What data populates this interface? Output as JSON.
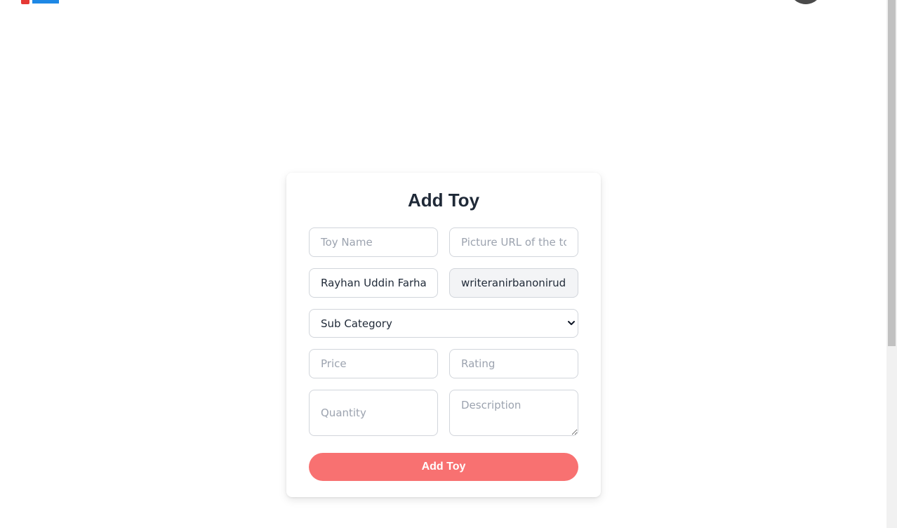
{
  "header": {
    "logo_icon": "toy-blocks-logo-icon",
    "avatar_icon": "user-avatar-icon"
  },
  "form": {
    "title": "Add Toy",
    "toy_name": {
      "value": "",
      "placeholder": "Toy Name"
    },
    "picture_url": {
      "value": "",
      "placeholder": "Picture URL of the toy"
    },
    "seller_name": {
      "value": "Rayhan Uddin Farhad"
    },
    "seller_email": {
      "value": "writeranirbanonirudro"
    },
    "sub_category": {
      "selected": "Sub Category"
    },
    "price": {
      "value": "",
      "placeholder": "Price"
    },
    "rating": {
      "value": "",
      "placeholder": "Rating"
    },
    "quantity": {
      "value": "",
      "placeholder": "Quantity"
    },
    "description": {
      "value": "",
      "placeholder": "Description"
    },
    "submit_label": "Add Toy"
  },
  "colors": {
    "accent": "#f87171",
    "title": "#1f2937",
    "border": "#d1d5db"
  }
}
